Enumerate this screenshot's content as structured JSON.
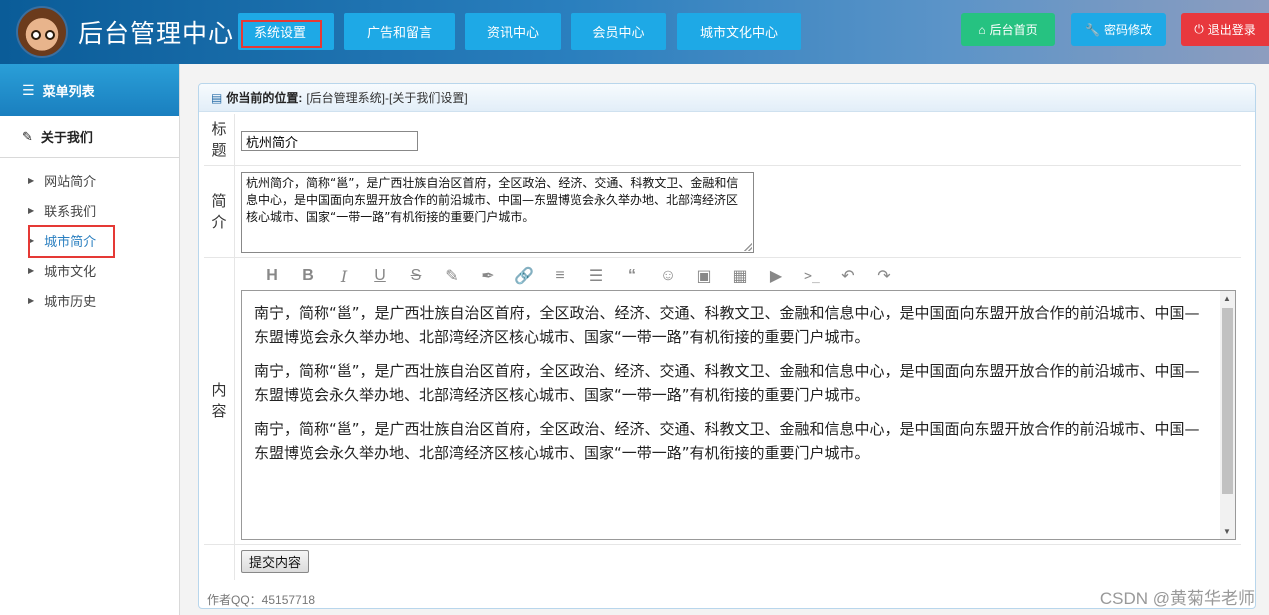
{
  "header": {
    "title": "后台管理中心",
    "nav": [
      "系统设置",
      "广告和留言",
      "资讯中心",
      "会员中心",
      "城市文化中心"
    ],
    "active_nav": "系统设置",
    "actions": [
      {
        "label": "后台首页",
        "icon": "home-icon",
        "color": "#26c281"
      },
      {
        "label": "密码修改",
        "icon": "wrench-icon",
        "color": "#1ea9e6"
      },
      {
        "label": "退出登录",
        "icon": "power-icon",
        "color": "#e8383d"
      }
    ]
  },
  "sidebar": {
    "header": "菜单列表",
    "section": "关于我们",
    "items": [
      {
        "label": "网站简介"
      },
      {
        "label": "联系我们"
      },
      {
        "label": "城市简介"
      },
      {
        "label": "城市文化"
      },
      {
        "label": "城市历史"
      }
    ],
    "active_item": "城市简介"
  },
  "breadcrumb": {
    "prefix": "你当前的位置:",
    "path": "[后台管理系统]-[关于我们设置]"
  },
  "form": {
    "title_label": [
      "标",
      "题"
    ],
    "title_value": "杭州简介",
    "intro_label": [
      "简",
      "介"
    ],
    "intro_value": "杭州简介，简称“邕”，是广西壮族自治区首府，全区政治、经济、交通、科教文卫、金融和信息中心，是中国面向东盟开放合作的前沿城市、中国—东盟博览会永久举办地、北部湾经济区核心城市、国家“一带一路”有机衔接的重要门户城市。",
    "content_label": [
      "内",
      "容"
    ],
    "content_paragraphs": [
      "南宁，简称“邕”，是广西壮族自治区首府，全区政治、经济、交通、科教文卫、金融和信息中心，是中国面向东盟开放合作的前沿城市、中国—东盟博览会永久举办地、北部湾经济区核心城市、国家“一带一路”有机衔接的重要门户城市。",
      "南宁，简称“邕”，是广西壮族自治区首府，全区政治、经济、交通、科教文卫、金融和信息中心，是中国面向东盟开放合作的前沿城市、中国—东盟博览会永久举办地、北部湾经济区核心城市、国家“一带一路”有机衔接的重要门户城市。",
      "南宁，简称“邕”，是广西壮族自治区首府，全区政治、经济、交通、科教文卫、金融和信息中心，是中国面向东盟开放合作的前沿城市、中国—东盟博览会永久举办地、北部湾经济区核心城市、国家“一带一路”有机衔接的重要门户城市。"
    ],
    "submit_label": "提交内容"
  },
  "toolbar_icons": [
    "heading-icon",
    "bold-icon",
    "italic-icon",
    "underline-icon",
    "strikethrough-icon",
    "pencil-icon",
    "brush-icon",
    "link-icon",
    "list-icon",
    "align-left-icon",
    "quote-icon",
    "emoji-icon",
    "image-icon",
    "table-icon",
    "video-icon",
    "code-icon",
    "undo-icon",
    "redo-icon"
  ],
  "footer": "作者QQ：45157718",
  "watermark": "CSDN @黄菊华老师"
}
